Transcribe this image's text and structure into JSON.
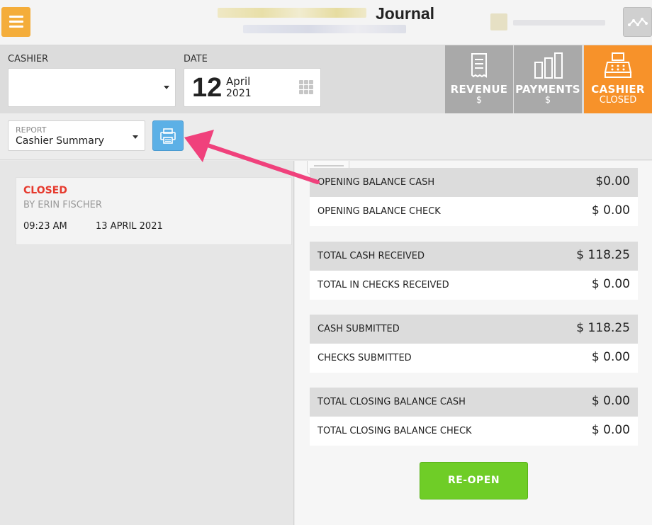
{
  "header": {
    "title": "Journal",
    "menu_icon": "hamburger-icon",
    "activity_icon": "activity-chart-icon"
  },
  "filters": {
    "cashier_label": "CASHIER",
    "cashier_value": "",
    "date_label": "DATE",
    "date_day": "12",
    "date_month": "April",
    "date_year": "2021"
  },
  "tabs": [
    {
      "title": "REVENUE",
      "subtitle": "$",
      "icon": "receipt-icon",
      "color": "#a9a9a9"
    },
    {
      "title": "PAYMENTS",
      "subtitle": "$",
      "icon": "bar-chart-icon",
      "color": "#a9a9a9"
    },
    {
      "title": "CASHIER",
      "subtitle": "CLOSED",
      "icon": "cash-register-icon",
      "color": "#f7922a",
      "active": true
    }
  ],
  "report": {
    "label": "REPORT",
    "value": "Cashier Summary",
    "print_icon": "printer-icon"
  },
  "session": {
    "status": "CLOSED",
    "by": "BY ERIN FISCHER",
    "time": "09:23 AM",
    "date": "13 APRIL 2021"
  },
  "summary": [
    {
      "label": "OPENING BALANCE CASH",
      "value": "$0.00"
    },
    {
      "label": "OPENING BALANCE CHECK",
      "value": "$ 0.00"
    },
    {
      "label": "TOTAL CASH RECEIVED",
      "value": "$ 118.25"
    },
    {
      "label": "TOTAL IN CHECKS RECEIVED",
      "value": "$ 0.00"
    },
    {
      "label": "CASH SUBMITTED",
      "value": "$ 118.25"
    },
    {
      "label": "CHECKS SUBMITTED",
      "value": "$ 0.00"
    },
    {
      "label": "TOTAL CLOSING BALANCE CASH",
      "value": "$ 0.00"
    },
    {
      "label": "TOTAL CLOSING BALANCE CHECK",
      "value": "$ 0.00"
    }
  ],
  "actions": {
    "reopen_label": "RE-OPEN"
  },
  "colors": {
    "accent_orange": "#f7922a",
    "menu_yellow": "#f4ad3a",
    "print_blue": "#5cb0e6",
    "reopen_green": "#6fcd27",
    "status_red": "#e63a2e",
    "annotation_pink": "#f0417c"
  }
}
